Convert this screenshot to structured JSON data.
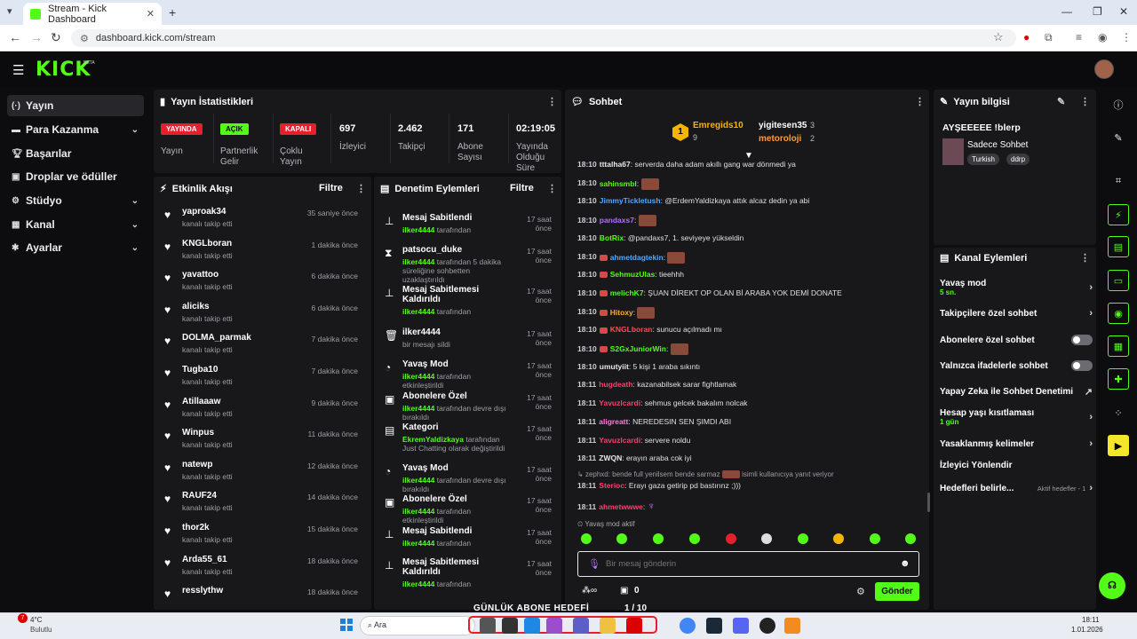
{
  "browser": {
    "tab_title": "Stream - Kick Dashboard",
    "url": "dashboard.kick.com/stream"
  },
  "nav": [
    {
      "label": "Yayın"
    },
    {
      "label": "Para Kazanma"
    },
    {
      "label": "Başarılar"
    },
    {
      "label": "Droplar ve ödüller"
    },
    {
      "label": "Stüdyo"
    },
    {
      "label": "Kanal"
    },
    {
      "label": "Ayarlar"
    }
  ],
  "stats": {
    "title": "Yayın İstatistikleri",
    "live_badge": "YAYINDA",
    "live_label": "Yayın",
    "open_badge": "AÇIK",
    "partner_label": "Partnerlik\nGelir",
    "closed_badge": "KAPALI",
    "multi_label": "Çoklu\nYayın",
    "viewers": "697",
    "viewers_label": "İzleyici",
    "followers": "2.462",
    "followers_label": "Takipçi",
    "subs": "171",
    "subs_label": "Abone\nSayısı",
    "uptime": "02:19:05",
    "uptime_label": "Yayında\nOlduğu\nSüre"
  },
  "activity": {
    "title": "Etkinlik Akışı",
    "filter": "Filtre",
    "items": [
      {
        "name": "yaproak34",
        "sub": "kanalı takip etti",
        "time": "35 saniye önce"
      },
      {
        "name": "KNGLboran",
        "sub": "kanalı takip etti",
        "time": "1 dakika önce"
      },
      {
        "name": "yavattoo",
        "sub": "kanalı takip etti",
        "time": "6 dakika önce"
      },
      {
        "name": "aliciks",
        "sub": "kanalı takip etti",
        "time": "6 dakika önce"
      },
      {
        "name": "DOLMA_parmak",
        "sub": "kanalı takip etti",
        "time": "7 dakika önce"
      },
      {
        "name": "Tugba10",
        "sub": "kanalı takip etti",
        "time": "7 dakika önce"
      },
      {
        "name": "Atillaaaw",
        "sub": "kanalı takip etti",
        "time": "9 dakika önce"
      },
      {
        "name": "Winpus",
        "sub": "kanalı takip etti",
        "time": "11 dakika önce"
      },
      {
        "name": "natewp",
        "sub": "kanalı takip etti",
        "time": "12 dakika önce"
      },
      {
        "name": "RAUF24",
        "sub": "kanalı takip etti",
        "time": "14 dakika önce"
      },
      {
        "name": "thor2k",
        "sub": "kanalı takip etti",
        "time": "15 dakika önce"
      },
      {
        "name": "Arda55_61",
        "sub": "kanalı takip etti",
        "time": "18 dakika önce"
      },
      {
        "name": "resslythw",
        "sub": "",
        "time": "18 dakika önce"
      }
    ]
  },
  "moderation": {
    "title": "Denetim Eylemleri",
    "filter": "Filtre",
    "items": [
      {
        "icon": "pin-icon",
        "glyph": "⊥",
        "name": "Mesaj Sabitlendi",
        "who": "ilker4444",
        "rest": "tarafından",
        "time": "17 saat önce"
      },
      {
        "icon": "hourglass-icon",
        "glyph": "⧗",
        "name": "patsocu_duke",
        "who": "ilker4444",
        "rest": "tarafından 5 dakika süreliğine sohbetten uzaklaştırıldı",
        "time": "17 saat önce"
      },
      {
        "icon": "unpin-icon",
        "glyph": "⊥",
        "name": "Mesaj Sabitlemesi Kaldırıldı",
        "who": "ilker4444",
        "rest": "tarafından",
        "time": "17 saat önce"
      },
      {
        "icon": "trash-icon",
        "glyph": "🗑",
        "name": "ilker4444",
        "who": "",
        "rest": "bir mesajı sildi",
        "time": "17 saat önce"
      },
      {
        "icon": "slow-mode-icon",
        "glyph": "◔",
        "name": "Yavaş Mod",
        "who": "ilker4444",
        "rest": "tarafından etkinleştirildi",
        "time": "17 saat önce"
      },
      {
        "icon": "gift-icon",
        "glyph": "▣",
        "name": "Abonelere Özel",
        "who": "ilker4444",
        "rest": "tarafından devre dışı bırakıldı",
        "time": "17 saat önce"
      },
      {
        "icon": "category-icon",
        "glyph": "▤",
        "name": "Kategori",
        "who": "EkremYaldizkaya",
        "rest": "tarafından Just Chatting olarak değiştirildi",
        "time": "17 saat önce"
      },
      {
        "icon": "slow-mode-icon",
        "glyph": "◔",
        "name": "Yavaş Mod",
        "who": "ilker4444",
        "rest": "tarafından devre dışı bırakıldı",
        "time": "17 saat önce"
      },
      {
        "icon": "gift-icon",
        "glyph": "▣",
        "name": "Abonelere Özel",
        "who": "ilker4444",
        "rest": "tarafından etkinleştirildi",
        "time": "17 saat önce"
      },
      {
        "icon": "pin-icon",
        "glyph": "⊥",
        "name": "Mesaj Sabitlendi",
        "who": "ilker4444",
        "rest": "tarafından",
        "time": "17 saat önce"
      },
      {
        "icon": "unpin-icon",
        "glyph": "⊥",
        "name": "Mesaj Sabitlemesi Kaldırıldı",
        "who": "ilker4444",
        "rest": "tarafından",
        "time": "17 saat önce"
      }
    ]
  },
  "chat": {
    "title": "Sohbet",
    "top": [
      {
        "rank": "1",
        "name": "Emregids10",
        "count": "9"
      },
      {
        "name": "yigitesen35",
        "count": "3"
      },
      {
        "name": "metoroloji",
        "count": "2"
      }
    ],
    "messages": [
      {
        "t": "18:10",
        "u": "tttalha67",
        "c": "#e8e8e8",
        "m": "serverda daha adam akıllı gang war dönmedi ya",
        "e": false
      },
      {
        "t": "18:10",
        "u": "sahinsmbl",
        "c": "#53fc18",
        "m": "",
        "e": true
      },
      {
        "t": "18:10",
        "u": "JimmyTickletush",
        "c": "#4ea8ff",
        "m": "@ErdemYaldizkaya attık alcaz dedin ya abi",
        "e": false
      },
      {
        "t": "18:10",
        "u": "pandaxs7",
        "c": "#b56cff",
        "m": "",
        "e": true
      },
      {
        "t": "18:10",
        "u": "BotRix",
        "c": "#53fc18",
        "m": "@pandaxs7, 1. seviyeye yükseldin",
        "e": false
      },
      {
        "t": "18:10",
        "u": "ahmetdagtekin",
        "c": "#4ea8ff",
        "m": "",
        "e": true
      },
      {
        "t": "18:10",
        "u": "SehmuzUlas",
        "c": "#53fc18",
        "m": "tieehhh",
        "e": false
      },
      {
        "t": "18:10",
        "u": "melichK7",
        "c": "#53fc18",
        "m": "ŞUAN DİREKT OP OLAN Bİ ARABA YOK DEMİ DONATE",
        "e": false
      },
      {
        "t": "18:10",
        "u": "Hitoxy",
        "c": "#ffb020",
        "m": "",
        "e": true
      },
      {
        "t": "18:10",
        "u": "KNGLboran",
        "c": "#ff4d4d",
        "m": "sunucu açılmadı mı",
        "e": false
      },
      {
        "t": "18:10",
        "u": "S2GxJuniorWin",
        "c": "#53fc18",
        "m": "",
        "e": true
      },
      {
        "t": "18:10",
        "u": "umutyiit",
        "c": "#e8e8e8",
        "m": "5 kişi 1 araba sıkıntı",
        "e": false
      },
      {
        "t": "18:11",
        "u": "hugdeath",
        "c": "#ff3d6e",
        "m": "kazanabilsek sarar fightlamak",
        "e": false
      },
      {
        "t": "18:11",
        "u": "Yavuzlcardi",
        "c": "#ff3d6e",
        "m": "sehmus gelcek bakalım nolcak",
        "e": false
      },
      {
        "t": "18:11",
        "u": "aligreatt",
        "c": "#ff7ad9",
        "m": "NEREDESIN SEN ŞIMDI ABI",
        "e": false
      },
      {
        "t": "18:11",
        "u": "Yavuzlcardi",
        "c": "#ff3d6e",
        "m": "servere noldu",
        "e": false
      },
      {
        "t": "18:11",
        "u": "ZWQN",
        "c": "#e8e8e8",
        "m": "erayın araba cok iyi",
        "e": false
      }
    ],
    "reply_note": "zephxd: bende full yenilsem bende sarmaz",
    "reply_tail": "isimli kullanıcıya yanıt veriyor",
    "reply_msg": {
      "t": "18:11",
      "u": "Sterioc",
      "m": "Erayı gaza getirip pd bastırınz ;)))"
    },
    "last_msg": {
      "t": "18:11",
      "u": "ahmetwwwe"
    },
    "slow_mode": "Yavaş mod aktif",
    "placeholder": "Bir mesaj gönderin",
    "count": "0",
    "send": "Gönder"
  },
  "info": {
    "title": "Yayın bilgisi",
    "stream_title": "AYŞEEEEE !blerp",
    "category": "Sadece Sohbet",
    "tags": [
      "Turkish",
      "ddrp"
    ]
  },
  "actions": {
    "title": "Kanal Eylemleri",
    "items": [
      {
        "label": "Yavaş mod",
        "sub": "5 sn.",
        "kind": "chev"
      },
      {
        "label": "Takipçilere özel sohbet",
        "sub": "",
        "kind": "chev"
      },
      {
        "label": "Abonelere özel sohbet",
        "sub": "",
        "kind": "toggle"
      },
      {
        "label": "Yalnızca ifadelerle sohbet",
        "sub": "",
        "kind": "toggle"
      },
      {
        "label": "Yapay Zeka ile Sohbet Denetimi",
        "sub": "",
        "kind": "ext"
      },
      {
        "label": "Hesap yaşı kısıtlaması",
        "sub": "1 gün",
        "kind": "chev"
      },
      {
        "label": "Yasaklanmış kelimeler",
        "sub": "",
        "kind": "chev"
      },
      {
        "label": "İzleyici Yönlendir",
        "sub": "",
        "kind": "none"
      },
      {
        "label": "Hedefleri belirle...",
        "sub": "",
        "kind": "chev",
        "extra": "Aktif hedefler - 1"
      }
    ]
  },
  "overlay": {
    "goal_text": "GÜNLÜK ABONE HEDEFİ",
    "goal_progress": "1 / 10"
  },
  "taskbar": {
    "weather_temp": "4°C",
    "weather_desc": "Bulutlu",
    "search": "Ara",
    "clock_time": "18:11",
    "clock_date": "1.01.2026",
    "notif_count": "7"
  },
  "colors": {
    "accent": "#53fc18",
    "live": "#e5202a",
    "panel": "#18181b"
  }
}
